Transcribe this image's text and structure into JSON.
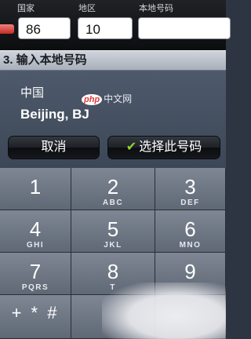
{
  "fields": {
    "country_label": "国家",
    "area_label": "地区",
    "local_label": "本地号码",
    "country_value": "86",
    "area_value": "10",
    "local_value": ""
  },
  "section": {
    "title": "3. 输入本地号码"
  },
  "info": {
    "country": "中国",
    "city": "Beijing, BJ"
  },
  "buttons": {
    "cancel": "取消",
    "select": "选择此号码",
    "check_glyph": "✔"
  },
  "watermark": {
    "logo": "php",
    "text": "中文网"
  },
  "keypad": {
    "keys": [
      {
        "num": "1",
        "letters": ""
      },
      {
        "num": "2",
        "letters": "ABC"
      },
      {
        "num": "3",
        "letters": "DEF"
      },
      {
        "num": "4",
        "letters": "GHI"
      },
      {
        "num": "5",
        "letters": "JKL"
      },
      {
        "num": "6",
        "letters": "MNO"
      },
      {
        "num": "7",
        "letters": "PQRS"
      },
      {
        "num": "8",
        "letters": "T"
      },
      {
        "num": "9",
        "letters": ""
      }
    ],
    "star_key": "+ * #"
  }
}
